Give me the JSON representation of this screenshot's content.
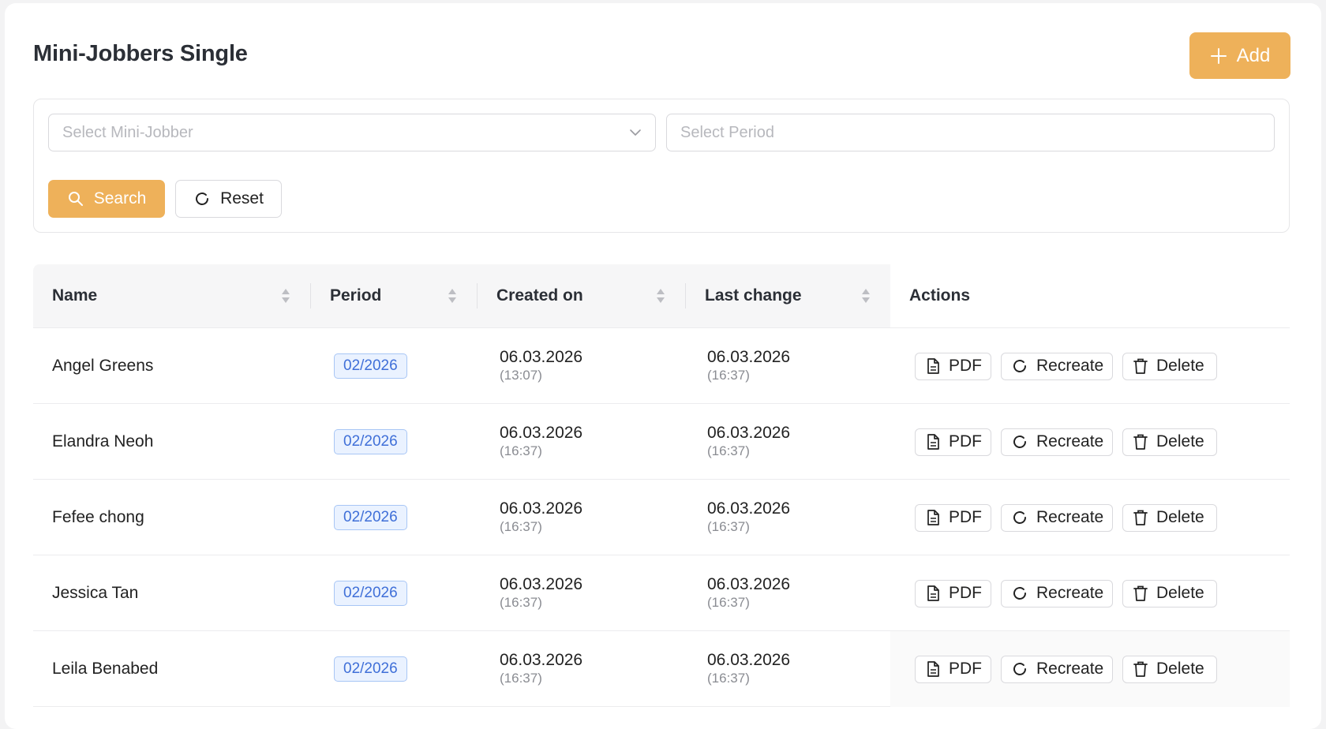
{
  "page": {
    "title": "Mini-Jobbers Single",
    "add_label": "Add"
  },
  "filters": {
    "jobber_placeholder": "Select Mini-Jobber",
    "period_placeholder": "Select Period",
    "search_label": "Search",
    "reset_label": "Reset"
  },
  "table": {
    "columns": {
      "name": "Name",
      "period": "Period",
      "created": "Created on",
      "changed": "Last change",
      "actions": "Actions"
    },
    "action_labels": {
      "pdf": "PDF",
      "recreate": "Recreate",
      "delete": "Delete"
    },
    "rows": [
      {
        "name": "Angel Greens",
        "period": "02/2026",
        "created_date": "06.03.2026",
        "created_time": "(13:07)",
        "changed_date": "06.03.2026",
        "changed_time": "(16:37)"
      },
      {
        "name": "Elandra Neoh",
        "period": "02/2026",
        "created_date": "06.03.2026",
        "created_time": "(16:37)",
        "changed_date": "06.03.2026",
        "changed_time": "(16:37)"
      },
      {
        "name": "Fefee chong",
        "period": "02/2026",
        "created_date": "06.03.2026",
        "created_time": "(16:37)",
        "changed_date": "06.03.2026",
        "changed_time": "(16:37)"
      },
      {
        "name": "Jessica Tan",
        "period": "02/2026",
        "created_date": "06.03.2026",
        "created_time": "(16:37)",
        "changed_date": "06.03.2026",
        "changed_time": "(16:37)"
      },
      {
        "name": "Leila Benabed",
        "period": "02/2026",
        "created_date": "06.03.2026",
        "created_time": "(16:37)",
        "changed_date": "06.03.2026",
        "changed_time": "(16:37)"
      }
    ]
  },
  "theme": {
    "accent": "#eeb15a",
    "tag_text": "#3f6fd8",
    "tag_bg": "#eaf2ff"
  }
}
